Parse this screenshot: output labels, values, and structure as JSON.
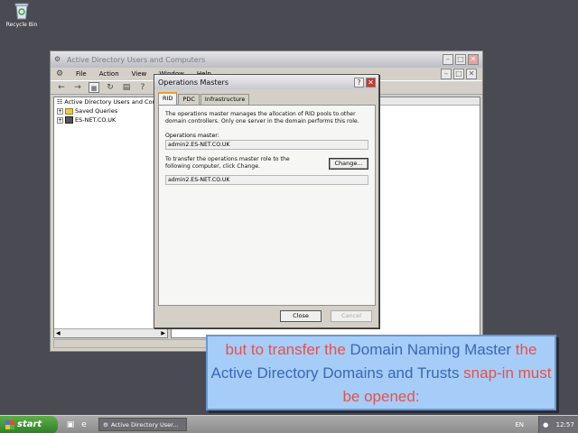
{
  "desktop": {
    "recycle_bin_label": "Recycle Bin"
  },
  "mmc": {
    "title": "Active Directory Users and Computers",
    "menu": [
      "File",
      "Action",
      "View",
      "Window",
      "Help"
    ],
    "tree": {
      "root": "Active Directory Users and Comp",
      "saved_queries": "Saved Queries",
      "domain": "ES-NET.CO.UK"
    }
  },
  "dialog": {
    "title": "Operations Masters",
    "tabs": [
      "RID",
      "PDC",
      "Infrastructure"
    ],
    "active_tab": "RID",
    "description": "The operations master manages the allocation of RID pools to other domain controllers. Only one server in the domain performs this role.",
    "operations_master_label": "Operations master:",
    "operations_master_value": "admin2.ES-NET.CO.UK",
    "transfer_text": "To transfer the operations master role to the following computer, click Change.",
    "change_button": "Change...",
    "transfer_target_value": "admin2.ES-NET.CO.UK",
    "close_button": "Close",
    "cancel_button": "Cancel"
  },
  "caption": {
    "part1": "but to transfer the ",
    "part2": "Domain Naming Master",
    "part3": " the ",
    "part4": "Active Directory Domains and Trusts",
    "part5": " snap-in must be opened:"
  },
  "taskbar": {
    "start_label": "start",
    "task_label": "Active Directory User...",
    "language": "EN",
    "clock": "12:57"
  },
  "colors": {
    "caption_red": "#e8504a",
    "caption_blue": "#3a66b8",
    "caption_background": "#a6cdf7"
  }
}
